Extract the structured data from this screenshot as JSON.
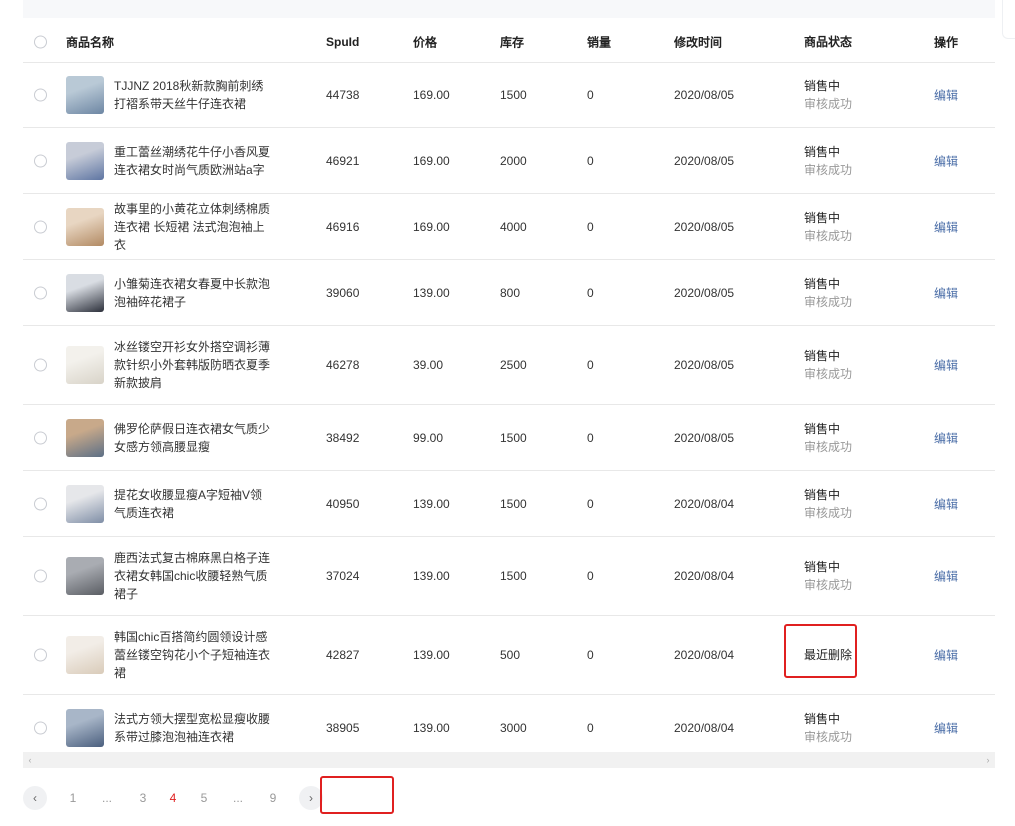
{
  "header": {
    "name": "商品名称",
    "spuid": "SpuId",
    "price": "价格",
    "stock": "库存",
    "sales": "销量",
    "mtime": "修改时间",
    "status": "商品状态",
    "op": "操作"
  },
  "rows": [
    {
      "name": "TJJNZ 2018秋新款胸前刺绣打褶系带天丝牛仔连衣裙",
      "spuid": "44738",
      "price": "169.00",
      "stock": "1500",
      "sales": "0",
      "time": "2020/08/05",
      "status": "销售中",
      "sub": "审核成功",
      "op": "编辑",
      "thumb": [
        "#b9c9d6",
        "#6d86a3"
      ]
    },
    {
      "name": "重工蕾丝潮绣花牛仔小香风夏连衣裙女时尚气质欧洲站a字",
      "spuid": "46921",
      "price": "169.00",
      "stock": "2000",
      "sales": "0",
      "time": "2020/08/05",
      "status": "销售中",
      "sub": "审核成功",
      "op": "编辑",
      "thumb": [
        "#c7ccd8",
        "#5e75a2"
      ]
    },
    {
      "name": "故事里的小黄花立体刺绣棉质连衣裙 长短裙 法式泡泡袖上衣",
      "spuid": "46916",
      "price": "169.00",
      "stock": "4000",
      "sales": "0",
      "time": "2020/08/05",
      "status": "销售中",
      "sub": "审核成功",
      "op": "编辑",
      "thumb": [
        "#e8d6c2",
        "#b28a63"
      ]
    },
    {
      "name": "小雏菊连衣裙女春夏中长款泡泡袖碎花裙子",
      "spuid": "39060",
      "price": "139.00",
      "stock": "800",
      "sales": "0",
      "time": "2020/08/05",
      "status": "销售中",
      "sub": "审核成功",
      "op": "编辑",
      "thumb": [
        "#d9dde3",
        "#2b2f3a"
      ]
    },
    {
      "name": "冰丝镂空开衫女外搭空调衫薄款针织小外套韩版防晒衣夏季新款披肩",
      "spuid": "46278",
      "price": "39.00",
      "stock": "2500",
      "sales": "0",
      "time": "2020/08/05",
      "status": "销售中",
      "sub": "审核成功",
      "op": "编辑",
      "thumb": [
        "#f3f1ec",
        "#d8d3c8"
      ]
    },
    {
      "name": "佛罗伦萨假日连衣裙女气质少女感方领高腰显瘦",
      "spuid": "38492",
      "price": "99.00",
      "stock": "1500",
      "sales": "0",
      "time": "2020/08/05",
      "status": "销售中",
      "sub": "审核成功",
      "op": "编辑",
      "thumb": [
        "#c8a98a",
        "#5c6f86"
      ]
    },
    {
      "name": "提花女收腰显瘦A字短袖V领气质连衣裙",
      "spuid": "40950",
      "price": "139.00",
      "stock": "1500",
      "sales": "0",
      "time": "2020/08/04",
      "status": "销售中",
      "sub": "审核成功",
      "op": "编辑",
      "thumb": [
        "#e6e7ea",
        "#7f8ea6"
      ]
    },
    {
      "name": "鹿西法式复古棉麻黑白格子连衣裙女韩国chic收腰轻熟气质裙子",
      "spuid": "37024",
      "price": "139.00",
      "stock": "1500",
      "sales": "0",
      "time": "2020/08/04",
      "status": "销售中",
      "sub": "审核成功",
      "op": "编辑",
      "thumb": [
        "#a9acb2",
        "#5a5d63"
      ]
    },
    {
      "name": "韩国chic百搭简约圆领设计感蕾丝镂空钩花小个子短袖连衣裙",
      "spuid": "42827",
      "price": "139.00",
      "stock": "500",
      "sales": "0",
      "time": "2020/08/04",
      "status": "最近删除",
      "sub": "",
      "op": "编辑",
      "thumb": [
        "#f2ede7",
        "#d9cbb9"
      ]
    },
    {
      "name": "法式方领大摆型宽松显瘦收腰系带过膝泡泡袖连衣裙",
      "spuid": "38905",
      "price": "139.00",
      "stock": "3000",
      "sales": "0",
      "time": "2020/08/04",
      "status": "销售中",
      "sub": "审核成功",
      "op": "编辑",
      "thumb": [
        "#a8b6c8",
        "#4b5f7e"
      ]
    }
  ],
  "pagination": {
    "prev_icon": "‹",
    "pages": [
      "1",
      "...",
      "3",
      "4",
      "5",
      "...",
      "9"
    ],
    "active": "4",
    "next_icon": "›"
  },
  "scroll": {
    "left_arrow": "‹",
    "right_arrow": "›"
  },
  "colors": {
    "accent_red": "#e02020",
    "link": "#4a6da7"
  }
}
